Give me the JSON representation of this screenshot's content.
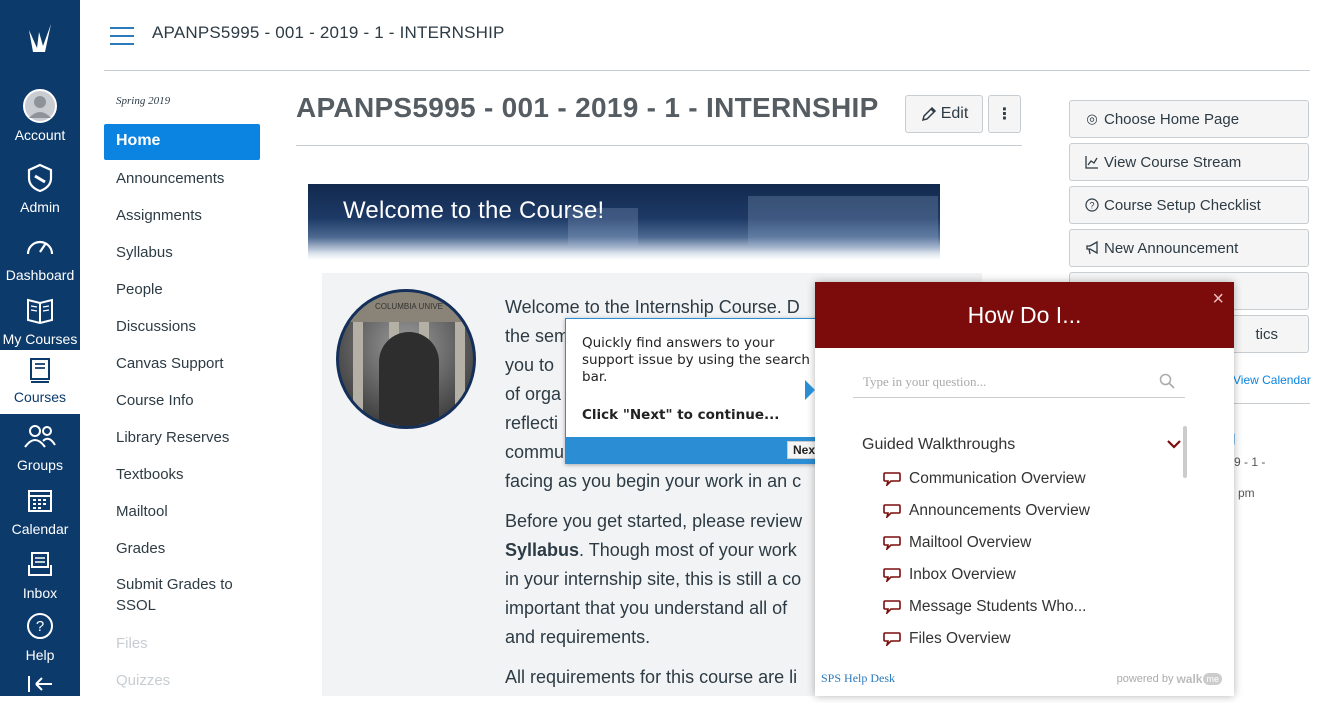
{
  "global_nav": {
    "items": [
      {
        "label": "Account",
        "icon": "account-icon"
      },
      {
        "label": "Admin",
        "icon": "admin-shield-icon"
      },
      {
        "label": "Dashboard",
        "icon": "dashboard-gauge-icon"
      },
      {
        "label": "My Courses",
        "icon": "my-courses-book-icon"
      },
      {
        "label": "Courses",
        "icon": "courses-icon"
      },
      {
        "label": "Groups",
        "icon": "groups-icon"
      },
      {
        "label": "Calendar",
        "icon": "calendar-icon"
      },
      {
        "label": "Inbox",
        "icon": "inbox-icon"
      },
      {
        "label": "Help",
        "icon": "help-icon"
      }
    ],
    "active": "Courses",
    "colors": {
      "bg": "#0c3a6b",
      "active_text": "#0c3a6b"
    }
  },
  "header": {
    "breadcrumb": "APANPS5995 - 001 - 2019 - 1 - INTERNSHIP"
  },
  "course_nav": {
    "term": "Spring 2019",
    "items": [
      "Home",
      "Announcements",
      "Assignments",
      "Syllabus",
      "People",
      "Discussions",
      "Canvas Support",
      "Course Info",
      "Library Reserves",
      "Textbooks",
      "Mailtool",
      "Grades",
      "Submit Grades to SSOL",
      "Files",
      "Quizzes"
    ],
    "active": "Home",
    "accent": "#0b84e1"
  },
  "main": {
    "title": "APANPS5995 - 001 - 2019 - 1 - INTERNSHIP",
    "edit_label": "Edit",
    "more_label": "⋮",
    "banner_text": "Welcome to the Course!",
    "statue_caption": "COLUMBIA UNIVE",
    "paragraphs": [
      {
        "lines": [
          "Welcome to the Internship Course. D",
          "the sem",
          "you to",
          "of orga",
          "reflecti",
          "commu",
          "facing as you begin your work in an c"
        ]
      },
      {
        "lines": [
          "Before you get started, please review",
          "Syllabus. Though most of your work",
          "in your internship site, this is still a co",
          "important that you understand all of",
          "and requirements."
        ]
      },
      {
        "lines": [
          "All requirements for this course are li"
        ]
      }
    ],
    "bold_word": "Syllabus"
  },
  "right_sidebar": {
    "buttons": [
      {
        "label": "Choose Home Page",
        "icon": "target-icon"
      },
      {
        "label": "View Course Stream",
        "icon": "stream-chart-icon"
      },
      {
        "label": "Course Setup Checklist",
        "icon": "question-circle-icon"
      },
      {
        "label": "New Announcement",
        "icon": "megaphone-icon"
      },
      {
        "label": "",
        "icon": ""
      },
      {
        "label": "tics",
        "icon": ""
      }
    ],
    "view_calendar": "View Calendar",
    "todo_fragment_1": "9 - 1 -",
    "todo_fragment_2": "pm"
  },
  "tooltip": {
    "close": "x",
    "message": "Quickly find answers to your support issue by using the search bar.",
    "continue_text": "Click \"Next\" to continue...",
    "next_label": "Next",
    "accent": "#2b8ed4"
  },
  "how_do_i": {
    "title": "How Do I...",
    "close": "×",
    "search_placeholder": "Type in your question...",
    "section": "Guided Walkthroughs",
    "items": [
      "Communication Overview",
      "Announcements Overview",
      "Mailtool Overview",
      "Inbox Overview",
      "Message Students Who...",
      "Files Overview"
    ],
    "footer_link": "SPS Help Desk",
    "powered_by": "powered by",
    "brand": "walk",
    "brand_me": "me",
    "header_color": "#7c0b0b"
  }
}
